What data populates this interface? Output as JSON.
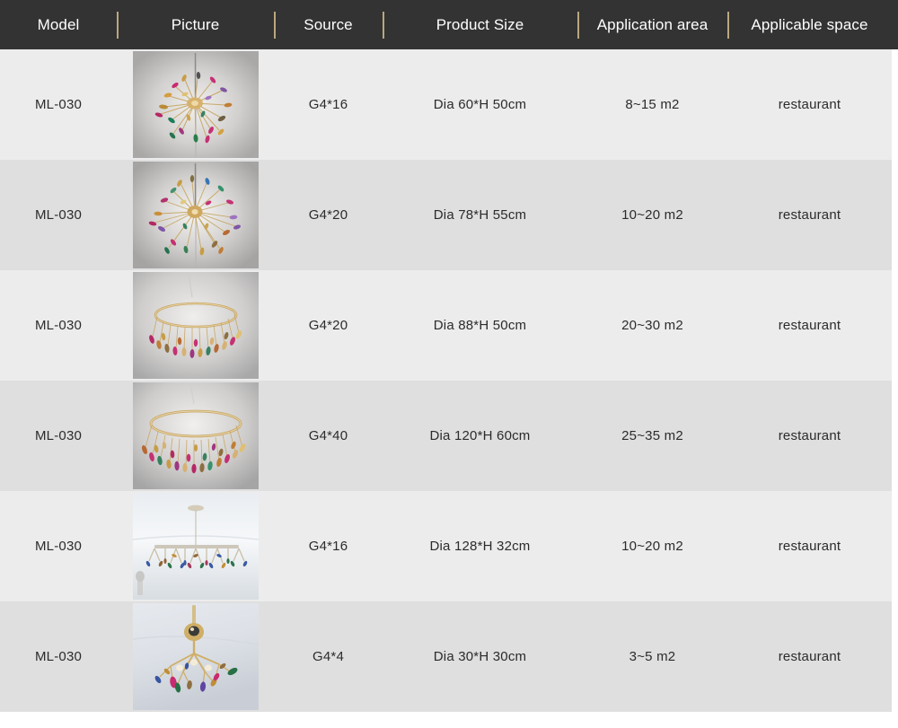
{
  "table": {
    "columns": [
      {
        "key": "model",
        "label": "Model"
      },
      {
        "key": "picture",
        "label": "Picture"
      },
      {
        "key": "source",
        "label": "Source"
      },
      {
        "key": "size",
        "label": "Product Size"
      },
      {
        "key": "area",
        "label": "Application area"
      },
      {
        "key": "space",
        "label": "Applicable space"
      }
    ],
    "rows": [
      {
        "model": "ML-030",
        "picture_alt": "firefly-branch-chandelier-sphere-small",
        "source": "G4*16",
        "size": "Dia 60*H 50cm",
        "area": "8~15 m2",
        "space": "restaurant"
      },
      {
        "model": "ML-030",
        "picture_alt": "firefly-branch-chandelier-sphere-medium",
        "source": "G4*20",
        "size": "Dia 78*H 55cm",
        "area": "10~20 m2",
        "space": "restaurant"
      },
      {
        "model": "ML-030",
        "picture_alt": "firefly-ring-chandelier-single-ring",
        "source": "G4*20",
        "size": "Dia 88*H 50cm",
        "area": "20~30 m2",
        "space": "restaurant"
      },
      {
        "model": "ML-030",
        "picture_alt": "firefly-ring-chandelier-large-ring",
        "source": "G4*40",
        "size": "Dia 120*H 60cm",
        "area": "25~35 m2",
        "space": "restaurant"
      },
      {
        "model": "ML-030",
        "picture_alt": "firefly-linear-bar-chandelier-ceiling",
        "source": "G4*16",
        "size": "Dia 128*H 32cm",
        "area": "10~20 m2",
        "space": "restaurant"
      },
      {
        "model": "ML-030",
        "picture_alt": "firefly-branch-chandelier-four-light",
        "source": "G4*4",
        "size": "Dia 30*H 30cm",
        "area": "3~5 m2",
        "space": "restaurant"
      }
    ]
  },
  "colors": {
    "header_background": "#333333",
    "header_text": "#ffffff",
    "header_divider": "#b9a87e",
    "row_odd": "#ececec",
    "row_even": "#dfdfdf",
    "body_text": "#2b2b2b"
  }
}
